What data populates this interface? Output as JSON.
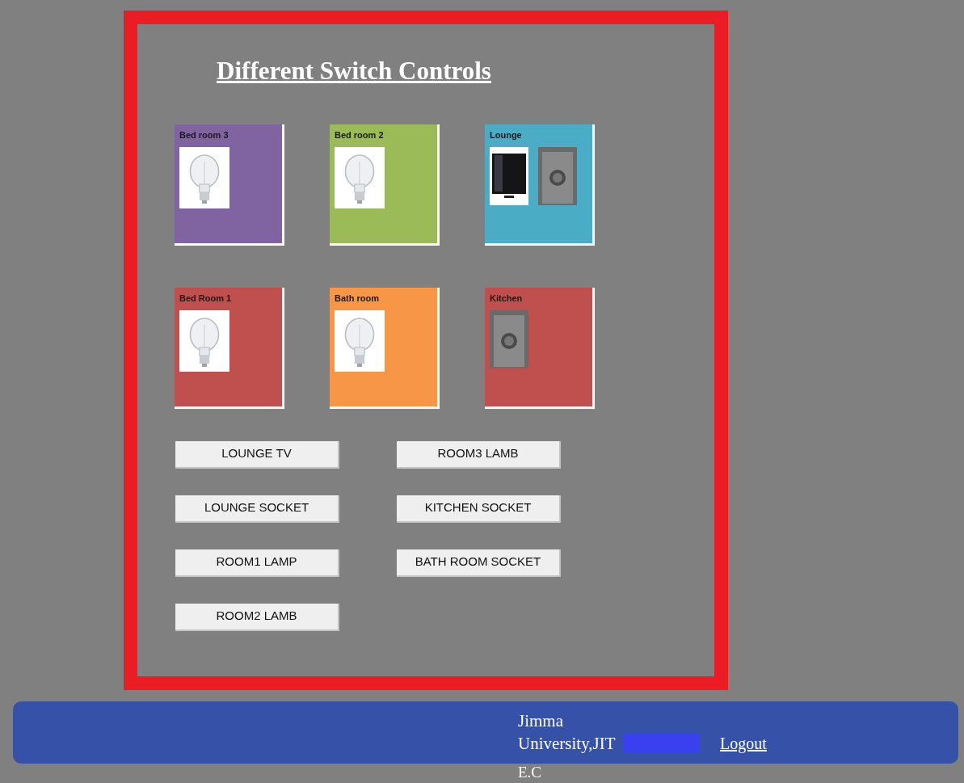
{
  "title": "Different Switch Controls",
  "tiles": [
    {
      "label": "Bed room 3",
      "color": "#8064a2"
    },
    {
      "label": "Bed room 2",
      "color": "#9bbb59"
    },
    {
      "label": "Lounge",
      "color": "#4bacc6"
    },
    {
      "label": "Bed Room 1",
      "color": "#c0504d"
    },
    {
      "label": "Bath room",
      "color": "#f79646"
    },
    {
      "label": "Kitchen",
      "color": "#c0504d"
    }
  ],
  "buttons": [
    [
      "LOUNGE TV",
      "ROOM3 LAMB"
    ],
    [
      "LOUNGE SOCKET",
      "KITCHEN SOCKET"
    ],
    [
      "ROOM1 LAMP",
      "BATH ROOM SOCKET"
    ],
    [
      "ROOM2 LAMB"
    ]
  ],
  "footer": {
    "text": "Jimma University,JIT",
    "text_2": "E.C",
    "logout": "Logout"
  }
}
